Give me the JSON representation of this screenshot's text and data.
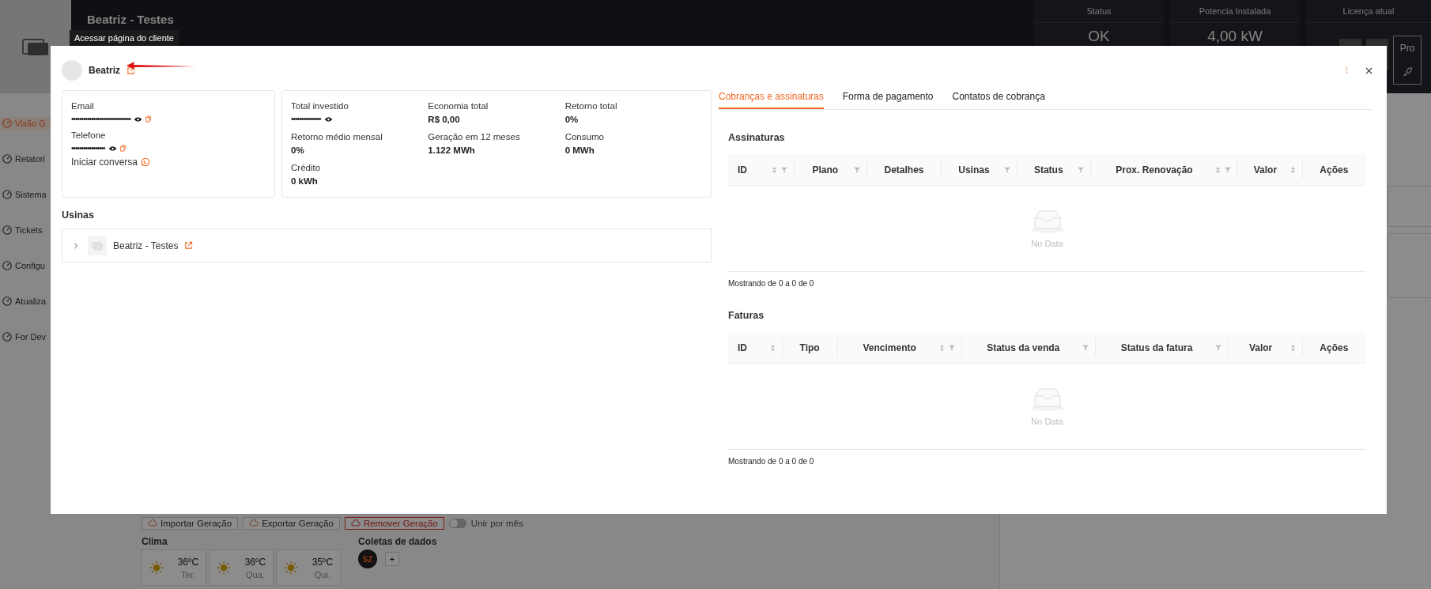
{
  "header": {
    "title": "Beatriz - Testes",
    "stats": [
      {
        "label": "Status",
        "value": "OK",
        "kind": "value"
      },
      {
        "label": "Potencia Instalada",
        "value": "4,00 kW",
        "kind": "value"
      },
      {
        "label": "Licença atual",
        "value": "Pro",
        "kind": "license"
      }
    ]
  },
  "sidebar": {
    "items": [
      {
        "label": "Visão G",
        "selected": true
      },
      {
        "label": "Relatori",
        "selected": false
      },
      {
        "label": "Sistema",
        "selected": false
      },
      {
        "label": "Tickets",
        "selected": false
      },
      {
        "label": "Configu",
        "selected": false
      },
      {
        "label": "Atualiza",
        "selected": false
      },
      {
        "label": "For Dev",
        "selected": false
      }
    ]
  },
  "background": {
    "actions": [
      {
        "label": "Importar Geração",
        "kind": "normal"
      },
      {
        "label": "Exportar Geração",
        "kind": "normal"
      },
      {
        "label": "Remover Geração",
        "kind": "danger"
      }
    ],
    "merge_toggle": {
      "label": "Unir por mês",
      "on": false
    },
    "weather": {
      "title": "Clima",
      "days": [
        {
          "temp": "36ºC",
          "day": "Ter."
        },
        {
          "temp": "36ºC",
          "day": "Qua."
        },
        {
          "temp": "35ºC",
          "day": "Qui."
        }
      ]
    },
    "data_collection": {
      "title": "Coletas de dados",
      "sources": [
        "SZ"
      ],
      "add": "+"
    }
  },
  "modal": {
    "tooltip": "Acessar página do cliente",
    "client": "Beatriz",
    "contact": {
      "fields": [
        {
          "label": "Email",
          "value": "••••••••••••••••••••••••••••••",
          "masked": true,
          "copyable": true
        },
        {
          "label": "Telefone",
          "value": "•••••••••••••••••",
          "masked": true,
          "copyable": true
        }
      ],
      "chat_link": "Iniciar conversa"
    },
    "summary": [
      {
        "label": "Total investido",
        "value": "•••••••••••••••",
        "masked": true
      },
      {
        "label": "Economia total",
        "value": "R$ 0,00",
        "masked": false
      },
      {
        "label": "Retorno total",
        "value": "0%",
        "masked": false
      },
      {
        "label": "Retorno médio mensal",
        "value": "0%",
        "masked": false
      },
      {
        "label": "Geração em 12 meses",
        "value": "1.122 MWh",
        "masked": false
      },
      {
        "label": "Consumo",
        "value": "0 MWh",
        "masked": false
      },
      {
        "label": "Crédito",
        "value": "0 kWh",
        "masked": false
      }
    ],
    "plants": {
      "title": "Usinas",
      "items": [
        {
          "name": "Beatriz - Testes",
          "expanded": false
        }
      ]
    },
    "tabs": [
      {
        "label": "Cobranças e assinaturas",
        "selected": true
      },
      {
        "label": "Forma de pagamento",
        "selected": false
      },
      {
        "label": "Contatos de cobrança",
        "selected": false
      }
    ],
    "tables": [
      {
        "title": "Assinaturas",
        "columns": [
          {
            "label": "ID",
            "sortable": true,
            "filterable": true
          },
          {
            "label": "Plano",
            "sortable": false,
            "filterable": true
          },
          {
            "label": "Detalhes",
            "sortable": false,
            "filterable": false
          },
          {
            "label": "Usinas",
            "sortable": false,
            "filterable": true
          },
          {
            "label": "Status",
            "sortable": false,
            "filterable": true
          },
          {
            "label": "Prox. Renovação",
            "sortable": true,
            "filterable": true
          },
          {
            "label": "Valor",
            "sortable": true,
            "filterable": false
          },
          {
            "label": "Ações",
            "sortable": false,
            "filterable": false
          }
        ],
        "empty_text": "No Data",
        "footer": "Mostrando de 0 a 0 de 0"
      },
      {
        "title": "Faturas",
        "columns": [
          {
            "label": "ID",
            "sortable": true,
            "filterable": false
          },
          {
            "label": "Tipo",
            "sortable": false,
            "filterable": false
          },
          {
            "label": "Vencimento",
            "sortable": true,
            "filterable": true
          },
          {
            "label": "Status da venda",
            "sortable": false,
            "filterable": true
          },
          {
            "label": "Status da fatura",
            "sortable": false,
            "filterable": true
          },
          {
            "label": "Valor",
            "sortable": true,
            "filterable": false
          },
          {
            "label": "Ações",
            "sortable": false,
            "filterable": false
          }
        ],
        "empty_text": "No Data",
        "footer": "Mostrando de 0 a 0 de 0"
      }
    ]
  }
}
